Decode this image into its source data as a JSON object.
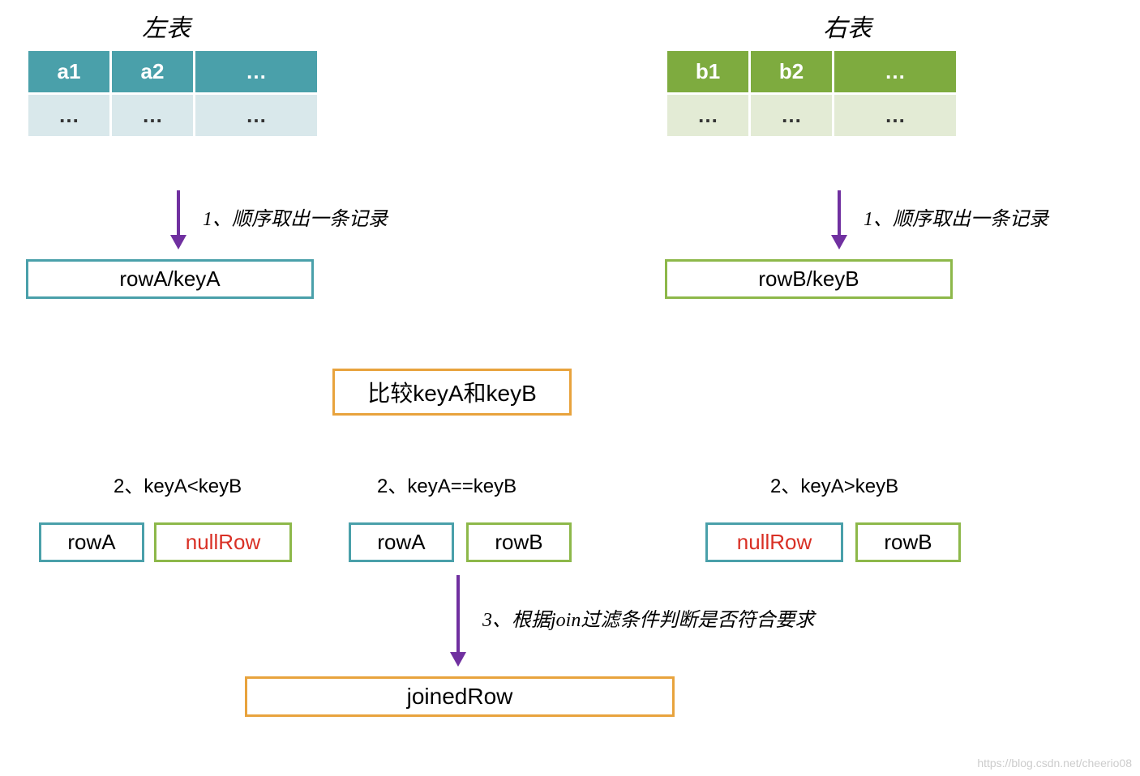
{
  "titles": {
    "left": "左表",
    "right": "右表"
  },
  "tables": {
    "left": {
      "h1": "a1",
      "h2": "a2",
      "h3": "…",
      "b1": "…",
      "b2": "…",
      "b3": "…"
    },
    "right": {
      "h1": "b1",
      "h2": "b2",
      "h3": "…",
      "b1": "…",
      "b2": "…",
      "b3": "…"
    }
  },
  "steps": {
    "s1": "1、顺序取出一条记录",
    "s2lt": "2、keyA<keyB",
    "s2eq": "2、keyA==keyB",
    "s2gt": "2、keyA>keyB",
    "s3": "3、根据join过滤条件判断是否符合要求"
  },
  "boxes": {
    "rowA_keyA": "rowA/keyA",
    "rowB_keyB": "rowB/keyB",
    "compare": "比较keyA和keyB",
    "rowA": "rowA",
    "rowB": "rowB",
    "nullRow": "nullRow",
    "joinedRow": "joinedRow"
  },
  "watermark": "https://blog.csdn.net/cheerio08"
}
